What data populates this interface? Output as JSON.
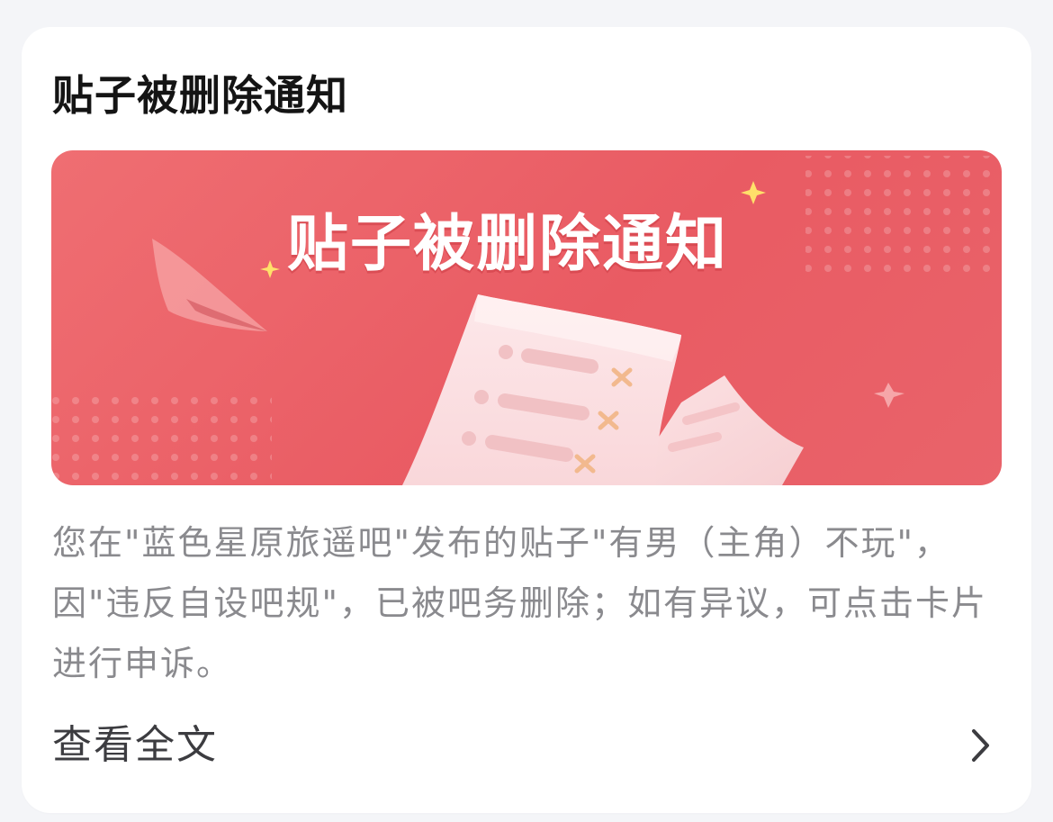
{
  "card": {
    "title": "贴子被删除通知",
    "banner": {
      "title": "贴子被删除通知",
      "image": "paper-scroll-with-x-marks-illustration",
      "colors": {
        "background": "#e95f67",
        "sparkle": "#ffe06a",
        "x_mark": "#f2b98e"
      }
    },
    "description": "您在\"蓝色星原旅遥吧\"发布的贴子\"有男（主角）不玩\"，因\"违反自设吧规\"，已被吧务删除；如有异议，可点击卡片进行申诉。",
    "footer": {
      "view_all_label": "查看全文",
      "chevron_icon": "chevron-right-icon"
    }
  }
}
